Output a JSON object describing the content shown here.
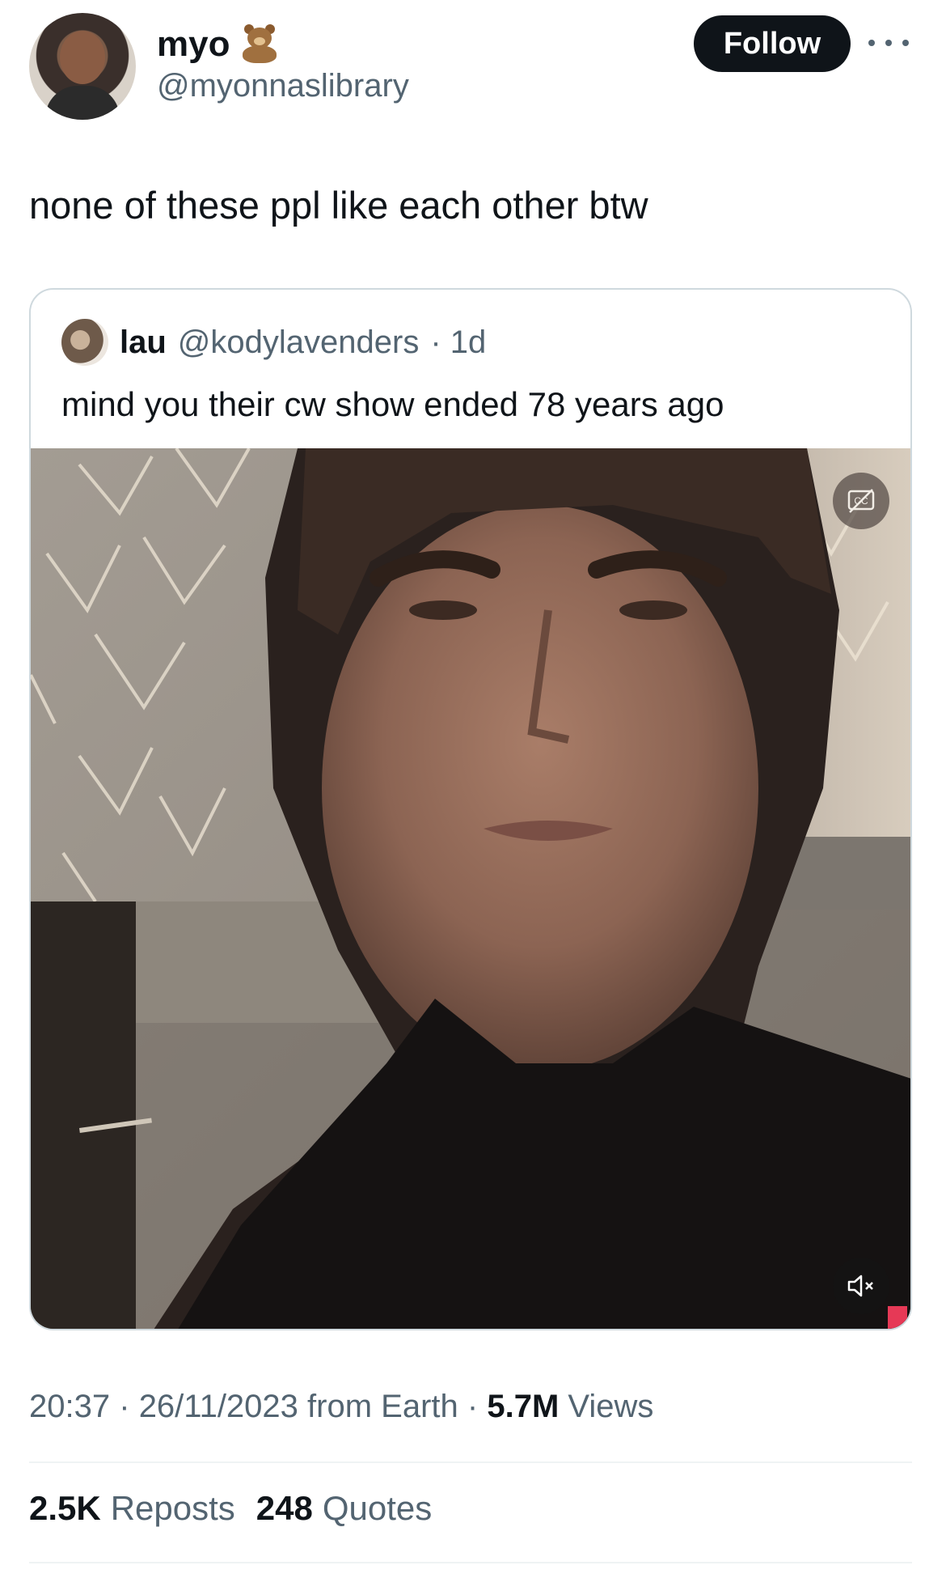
{
  "author": {
    "display_name": "myo",
    "emoji": "teddy-bear",
    "handle": "@myonnaslibrary"
  },
  "follow_label": "Follow",
  "tweet_text": "none of these ppl like each other btw",
  "quoted": {
    "display_name": "lau",
    "handle": "@kodylavenders",
    "time": "· 1d",
    "text": "mind you their cw show ended 78 years ago"
  },
  "meta": {
    "time": "20:37",
    "sep1": "·",
    "date": "26/11/2023",
    "source": "from Earth",
    "sep2": "·",
    "views_count": "5.7M",
    "views_label": "Views"
  },
  "stats": {
    "reposts_count": "2.5K",
    "reposts_label": "Reposts",
    "quotes_count": "248",
    "quotes_label": "Quotes"
  },
  "colors": {
    "text_primary": "#0f1419",
    "text_secondary": "#536471",
    "border": "#cfd9de"
  }
}
